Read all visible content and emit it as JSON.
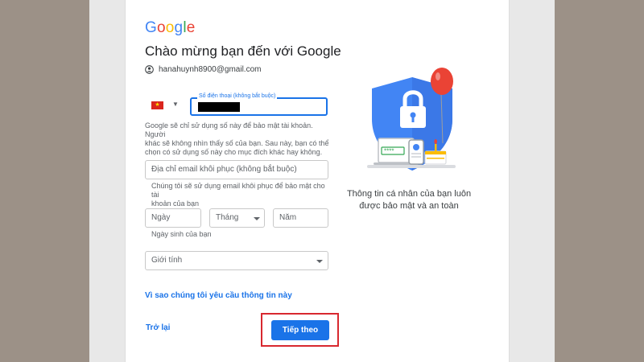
{
  "logo": {
    "text": "Google",
    "colors": [
      "#4285f4",
      "#ea4335",
      "#fbbc05",
      "#4285f4",
      "#34a853",
      "#ea4335"
    ]
  },
  "page_title": "Chào mừng bạn đến với Google",
  "account": {
    "email": "hanahuynh8900@gmail.com",
    "icon": "account-circle-icon"
  },
  "phone": {
    "country_flag": "vietnam-flag-icon",
    "label": "Số điện thoại (không bắt buộc)",
    "value_redacted": true,
    "help": [
      "Google sẽ chỉ sử dụng số này để bảo mật tài khoản. Người",
      "khác sẽ không nhìn thấy số của bạn. Sau này, bạn có thể",
      "chọn có sử dụng số này cho mục đích khác hay không."
    ]
  },
  "recovery_email": {
    "placeholder": "Địa chỉ email khôi phục (không bắt buộc)",
    "help": [
      "Chúng tôi sẽ sử dụng email khôi phục để bảo mật cho tài",
      "khoản của bạn"
    ]
  },
  "birthday": {
    "day_placeholder": "Ngày",
    "month_placeholder": "Tháng",
    "year_placeholder": "Năm",
    "help": "Ngày sinh của bạn"
  },
  "gender": {
    "placeholder": "Giới tính"
  },
  "why_link": "Vì sao chúng tôi yêu cầu thông tin này",
  "back_button": "Trở lại",
  "next_button": "Tiếp theo",
  "illustration": {
    "caption_line1": "Thông tin cá nhân của bạn luôn",
    "caption_line2": "được bảo mật và an toàn",
    "password_dots": "****"
  },
  "colors": {
    "accent": "#1a73e8",
    "highlight_box": "#d8282f",
    "shield": "#4285f4",
    "balloon": "#ea4335"
  }
}
